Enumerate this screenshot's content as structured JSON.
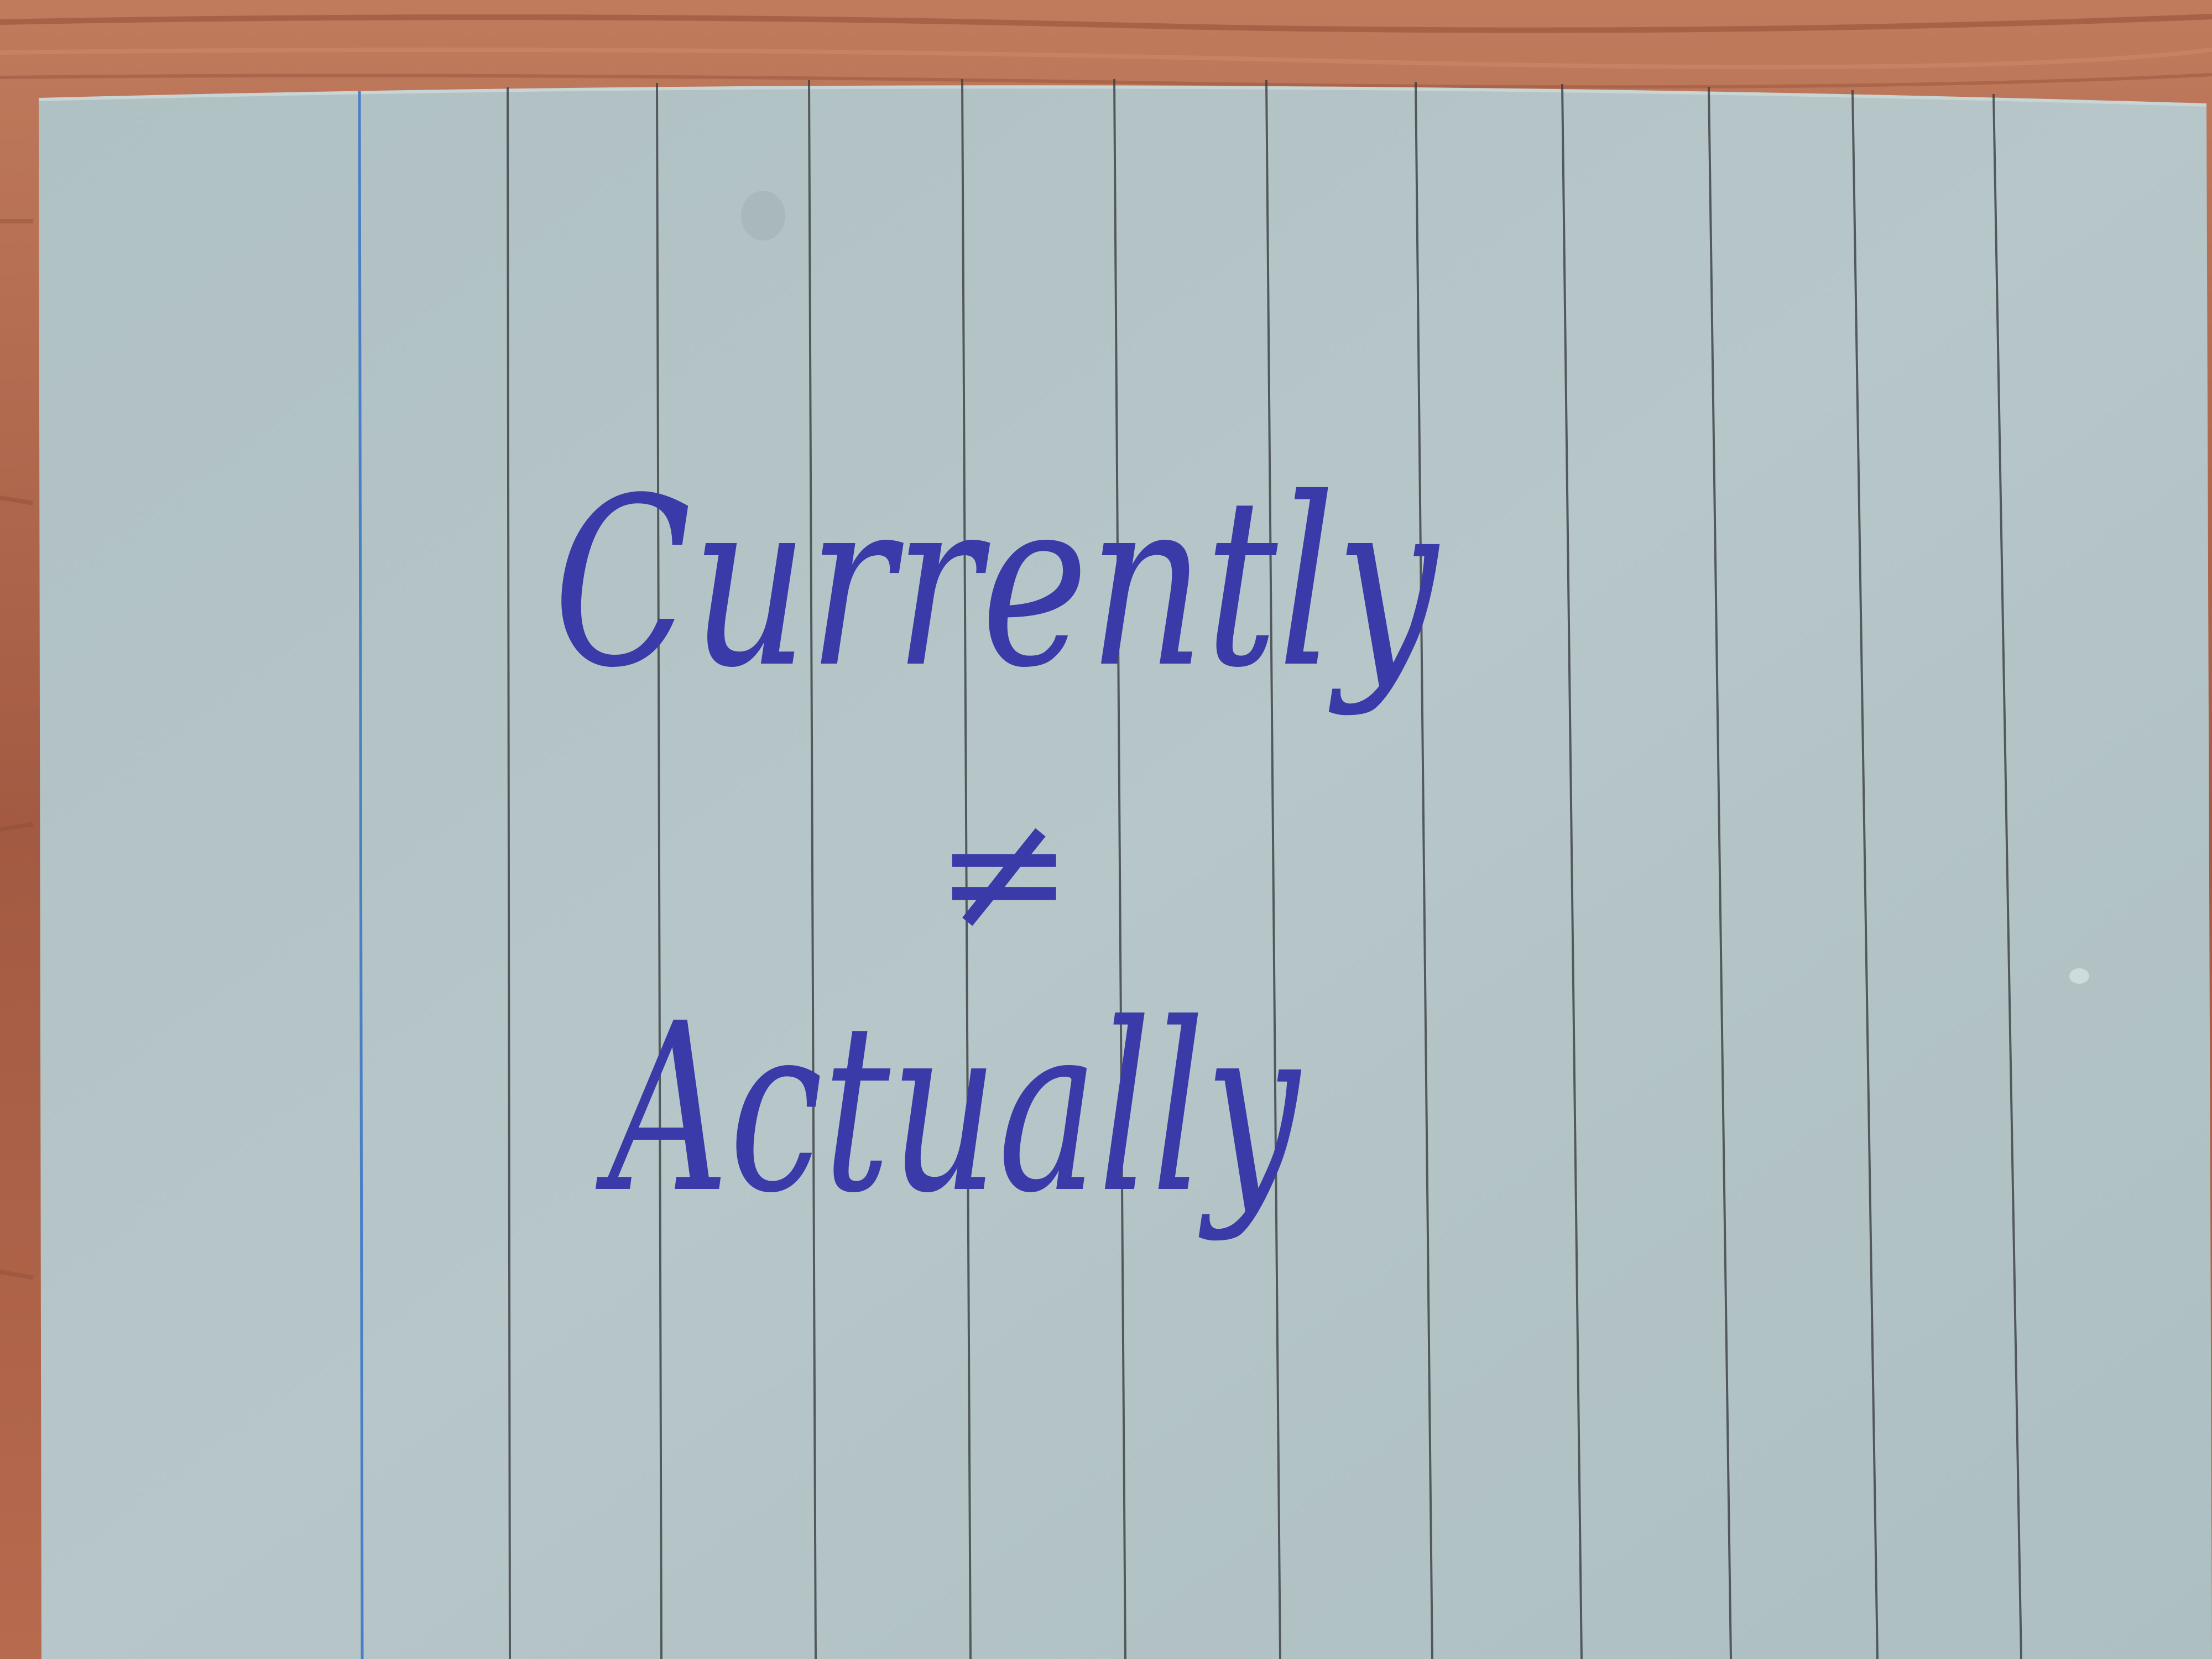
{
  "photo": {
    "line_1": "Currently",
    "symbol": "≠",
    "line_2": "Actually"
  },
  "colors": {
    "table_wood": "#a8604a",
    "card": "#b3c3c4",
    "ink": "#3a3aa8",
    "ruled_line": "#3a3f44",
    "margin_line": "#4a7fc6"
  }
}
